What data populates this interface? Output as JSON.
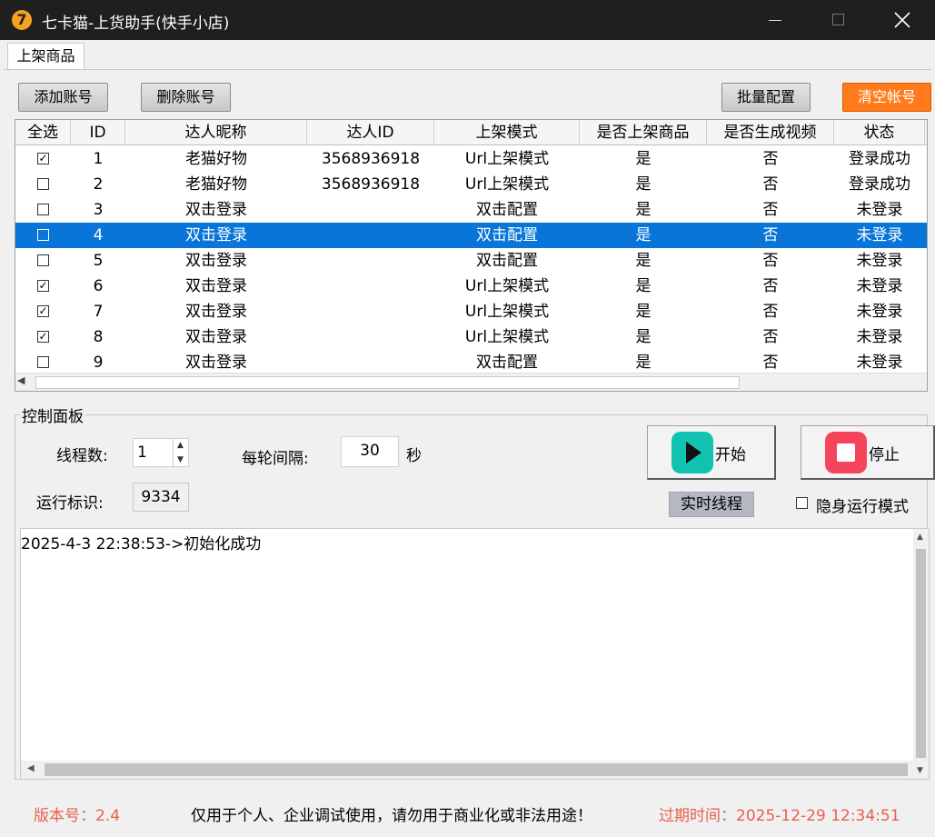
{
  "window": {
    "icon_glyph": "7",
    "title": "七卡猫-上货助手(快手小店)"
  },
  "tabs": [
    {
      "label": "上架商品"
    }
  ],
  "toolbar": {
    "add_account": "添加账号",
    "delete_account": "删除账号",
    "batch_config": "批量配置",
    "clear_accounts": "清空帐号"
  },
  "table": {
    "headers": [
      "全选",
      "ID",
      "达人昵称",
      "达人ID",
      "上架模式",
      "是否上架商品",
      "是否生成视频",
      "状态"
    ],
    "rows": [
      {
        "checked": "☑",
        "id": "1",
        "nickname": "老猫好物",
        "talent_id": "3568936918",
        "mode": "Url上架模式",
        "list_goods": "是",
        "gen_video": "否",
        "status": "登录成功"
      },
      {
        "checked": "☐",
        "id": "2",
        "nickname": "老猫好物",
        "talent_id": "3568936918",
        "mode": "Url上架模式",
        "list_goods": "是",
        "gen_video": "否",
        "status": "登录成功"
      },
      {
        "checked": "☐",
        "id": "3",
        "nickname": "双击登录",
        "talent_id": "",
        "mode": "双击配置",
        "list_goods": "是",
        "gen_video": "否",
        "status": "未登录"
      },
      {
        "checked": "☐",
        "id": "4",
        "nickname": "双击登录",
        "talent_id": "",
        "mode": "双击配置",
        "list_goods": "是",
        "gen_video": "否",
        "status": "未登录"
      },
      {
        "checked": "☐",
        "id": "5",
        "nickname": "双击登录",
        "talent_id": "",
        "mode": "双击配置",
        "list_goods": "是",
        "gen_video": "否",
        "status": "未登录"
      },
      {
        "checked": "☑",
        "id": "6",
        "nickname": "双击登录",
        "talent_id": "",
        "mode": "Url上架模式",
        "list_goods": "是",
        "gen_video": "否",
        "status": "未登录"
      },
      {
        "checked": "☑",
        "id": "7",
        "nickname": "双击登录",
        "talent_id": "",
        "mode": "Url上架模式",
        "list_goods": "是",
        "gen_video": "否",
        "status": "未登录"
      },
      {
        "checked": "☑",
        "id": "8",
        "nickname": "双击登录",
        "talent_id": "",
        "mode": "Url上架模式",
        "list_goods": "是",
        "gen_video": "否",
        "status": "未登录"
      },
      {
        "checked": "☐",
        "id": "9",
        "nickname": "双击登录",
        "talent_id": "",
        "mode": "双击配置",
        "list_goods": "是",
        "gen_video": "否",
        "status": "未登录"
      }
    ]
  },
  "control_panel": {
    "title": "控制面板",
    "threads_label": "线程数:",
    "threads_value": "1",
    "interval_label": "每轮间隔:",
    "interval_value": "30",
    "interval_unit": "秒",
    "run_id_label": "运行标识:",
    "run_id_value": "9334",
    "start_label": "开始",
    "stop_label": "停止",
    "realtime_threads": "实时线程",
    "stealth_label": "隐身运行模式"
  },
  "log": {
    "lines": [
      "2025-4-3 22:38:53->初始化成功"
    ]
  },
  "footer": {
    "version": "版本号：2.4",
    "notice": "仅用于个人、企业调试使用，请勿用于商业化或非法用途！",
    "expiry": "过期时间：2025-12-29 12:34:51"
  },
  "colors": {
    "title_bar": "#1f1f1f",
    "selected_row": "#0a75d8",
    "start_icon": "#12c2b0",
    "stop_icon": "#f5455c",
    "orange_button": "#ff7a1a",
    "footer_red": "#e8604c"
  },
  "icons": {
    "app": "app-logo-icon",
    "start": "play-icon",
    "stop": "stop-icon",
    "minimize": "minimize-icon",
    "maximize": "maximize-icon",
    "close": "close-icon"
  }
}
